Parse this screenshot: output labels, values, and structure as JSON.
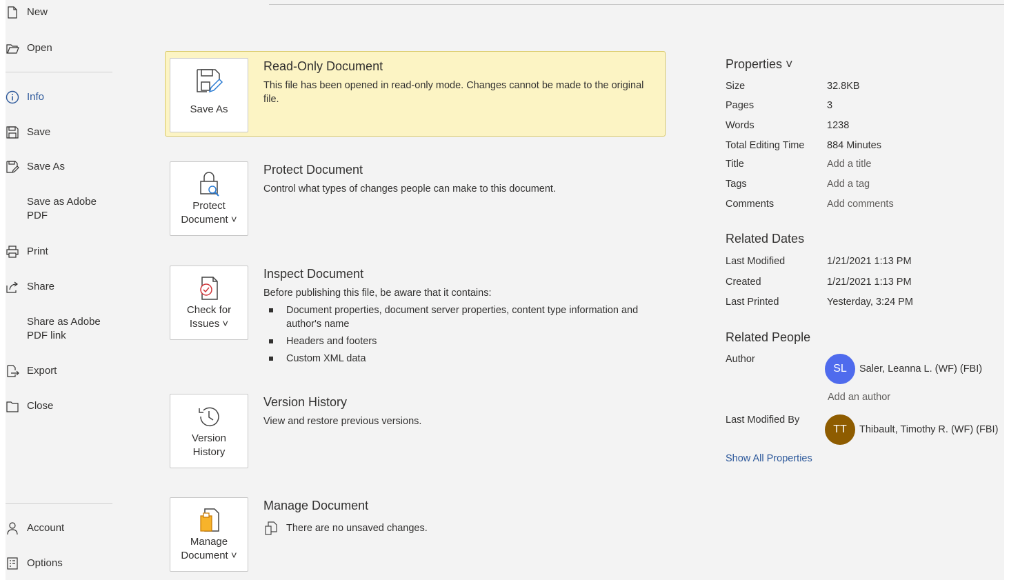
{
  "nav": {
    "new": "New",
    "open": "Open",
    "info": "Info",
    "save": "Save",
    "save_as": "Save As",
    "save_adobe_pdf": "Save as Adobe\nPDF",
    "print": "Print",
    "share": "Share",
    "share_adobe_link": "Share as Adobe\nPDF link",
    "export": "Export",
    "close": "Close",
    "account": "Account",
    "options": "Options"
  },
  "sections": {
    "readonly": {
      "button": "Save As",
      "title": "Read-Only Document",
      "desc": "This file has been opened in read-only mode. Changes cannot be made to the original file."
    },
    "protect": {
      "button": "Protect\nDocument ˅",
      "title": "Protect Document",
      "desc": "Control what types of changes people can make to this document."
    },
    "inspect": {
      "button": "Check for\nIssues ˅",
      "title": "Inspect Document",
      "desc": "Before publishing this file, be aware that it contains:",
      "items": [
        "Document properties, document server properties, content type information and author's name",
        "Headers and footers",
        "Custom XML data"
      ]
    },
    "version": {
      "button": "Version\nHistory",
      "title": "Version History",
      "desc": "View and restore previous versions."
    },
    "manage": {
      "button": "Manage\nDocument ˅",
      "title": "Manage Document",
      "desc": "There are no unsaved changes."
    }
  },
  "properties": {
    "header": "Properties ˅",
    "size_label": "Size",
    "size": "32.8KB",
    "pages_label": "Pages",
    "pages": "3",
    "words_label": "Words",
    "words": "1238",
    "editing_label": "Total Editing Time",
    "editing": "884 Minutes",
    "title_label": "Title",
    "title": "Add a title",
    "tags_label": "Tags",
    "tags": "Add a tag",
    "comments_label": "Comments",
    "comments": "Add comments"
  },
  "related_dates": {
    "header": "Related Dates",
    "last_modified_label": "Last Modified",
    "last_modified": "1/21/2021 1:13 PM",
    "created_label": "Created",
    "created": "1/21/2021 1:13 PM",
    "last_printed_label": "Last Printed",
    "last_printed": "Yesterday, 3:24 PM"
  },
  "related_people": {
    "header": "Related People",
    "author_label": "Author",
    "author_initials": "SL",
    "author_name": "Saler, Leanna L. (WF) (FBI)",
    "author_color": "#4f6bed",
    "add_author": "Add an author",
    "last_modified_by_label": "Last Modified By",
    "modifier_initials": "TT",
    "modifier_name": "Thibault, Timothy R. (WF) (FBI)",
    "modifier_color": "#8e5c00"
  },
  "show_all": "Show All Properties"
}
